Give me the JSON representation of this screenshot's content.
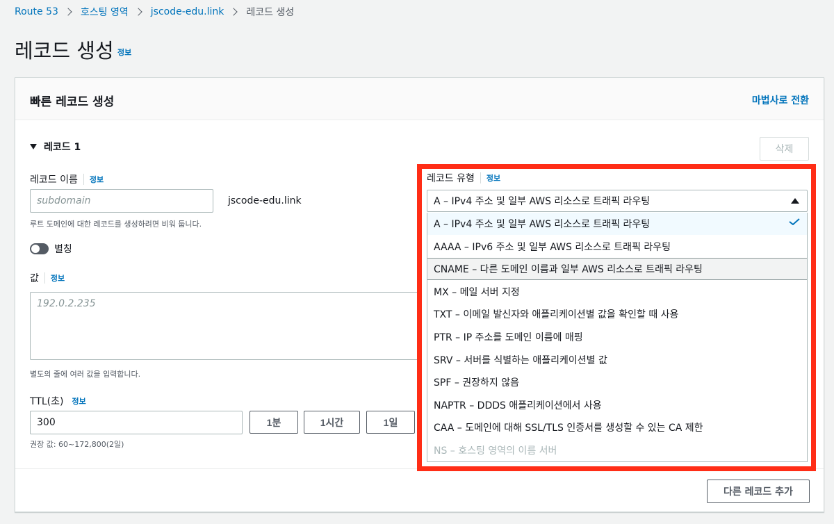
{
  "breadcrumb": {
    "items": [
      "Route 53",
      "호스팅 영역",
      "jscode-edu.link",
      "레코드 생성"
    ]
  },
  "page": {
    "title": "레코드 생성",
    "info": "정보"
  },
  "panel": {
    "title": "빠른 레코드 생성",
    "wizard_link": "마법사로 전환",
    "record_toggle": "레코드 1",
    "delete_button": "삭제",
    "add_record_button": "다른 레코드 추가"
  },
  "record_name": {
    "label": "레코드 이름",
    "info": "정보",
    "placeholder": "subdomain",
    "suffix": "jscode-edu.link",
    "hint": "루트 도메인에 대한 레코드를 생성하려면 비워 둡니다."
  },
  "alias": {
    "label": "별칭",
    "enabled": false
  },
  "value": {
    "label": "값",
    "info": "정보",
    "placeholder": "192.0.2.235",
    "hint": "별도의 줄에 여러 값을 입력합니다."
  },
  "ttl": {
    "label": "TTL(초)",
    "info": "정보",
    "value": "300",
    "hint": "권장 값: 60~172,800(2일)",
    "buttons": [
      "1분",
      "1시간",
      "1일"
    ]
  },
  "record_type": {
    "label": "레코드 유형",
    "info": "정보",
    "selected": "A – IPv4 주소 및 일부 AWS 리소스로 트래픽 라우팅",
    "options": [
      {
        "label": "A – IPv4 주소 및 일부 AWS 리소스로 트래픽 라우팅",
        "state": "selected"
      },
      {
        "label": "AAAA – IPv6 주소 및 일부 AWS 리소스로 트래픽 라우팅",
        "state": "normal"
      },
      {
        "label": "CNAME – 다른 도메인 이름과 일부 AWS 리소스로 트래픽 라우팅",
        "state": "hover"
      },
      {
        "label": "MX – 메일 서버 지정",
        "state": "normal"
      },
      {
        "label": "TXT – 이메일 발신자와 애플리케이션별 값을 확인할 때 사용",
        "state": "normal"
      },
      {
        "label": "PTR – IP 주소를 도메인 이름에 매핑",
        "state": "normal"
      },
      {
        "label": "SRV – 서버를 식별하는 애플리케이션별 값",
        "state": "normal"
      },
      {
        "label": "SPF – 권장하지 않음",
        "state": "normal"
      },
      {
        "label": "NAPTR – DDDS 애플리케이션에서 사용",
        "state": "normal"
      },
      {
        "label": "CAA – 도메인에 대해 SSL/TLS 인증서를 생성할 수 있는 CA 제한",
        "state": "normal"
      },
      {
        "label": "NS – 호스팅 영역의 이름 서버",
        "state": "disabled"
      }
    ]
  },
  "colors": {
    "link": "#0073bb",
    "highlight": "#ff2d16",
    "check": "#0073bb"
  }
}
